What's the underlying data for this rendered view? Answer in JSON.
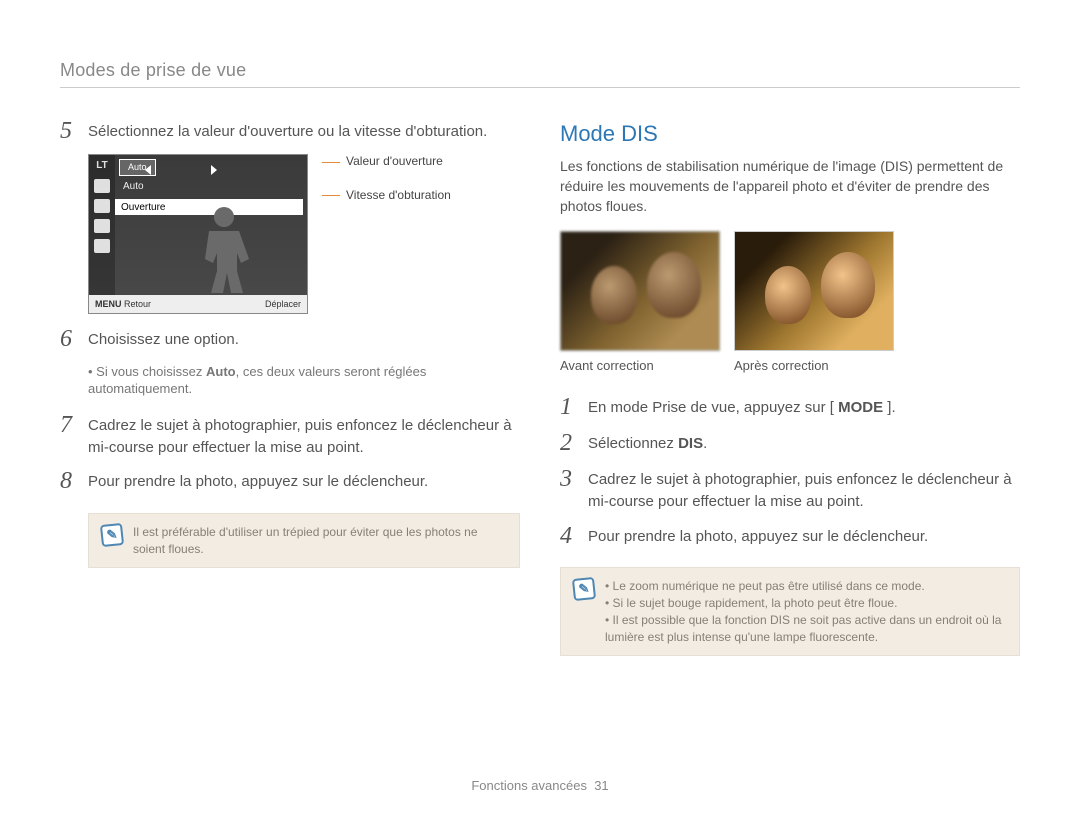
{
  "header": {
    "breadcrumb": "Modes de prise de vue"
  },
  "left": {
    "step5": "Sélectionnez la valeur d'ouverture ou la vitesse d'obturation.",
    "lcd": {
      "lt": "LT",
      "row1_pill": "Auto",
      "row2_lbl": "Auto",
      "openline": "Ouverture",
      "footer_menu": "MENU",
      "footer_ret": "Retour",
      "footer_dep": "Déplacer"
    },
    "annot": {
      "a1": "Valeur d'ouverture",
      "a2": "Vitesse d'obturation"
    },
    "step6": "Choisissez une option.",
    "step6_note_pre": "Si vous choisissez ",
    "step6_note_bold": "Auto",
    "step6_note_post": ", ces deux valeurs seront réglées automatiquement.",
    "step7": "Cadrez le sujet à photographier, puis enfoncez le déclencheur à mi-course pour effectuer la mise au point.",
    "step8": "Pour prendre la photo, appuyez sur le déclencheur.",
    "note": "Il est préférable d'utiliser un trépied pour éviter que les photos ne soient floues."
  },
  "right": {
    "title": "Mode DIS",
    "intro": "Les fonctions de stabilisation numérique de l'image (DIS) permettent de réduire les mouvements de l'appareil photo et d'éviter de prendre des photos floues.",
    "cap_before": "Avant correction",
    "cap_after": "Après correction",
    "step1_pre": "En mode Prise de vue, appuyez sur [ ",
    "step1_bold": "MODE",
    "step1_post": " ].",
    "step2_pre": "Sélectionnez ",
    "step2_bold": "DIS",
    "step2_post": ".",
    "step3": "Cadrez le sujet à photographier, puis enfoncez le déclencheur à mi-course pour effectuer la mise au point.",
    "step4": "Pour prendre la photo, appuyez sur le déclencheur.",
    "notes": {
      "n1": "Le zoom numérique ne peut pas être utilisé dans ce mode.",
      "n2": "Si le sujet bouge rapidement, la photo peut être floue.",
      "n3": "Il est possible que la fonction DIS ne soit pas active dans un endroit où la lumière est plus intense qu'une lampe fluorescente."
    }
  },
  "footer": {
    "section": "Fonctions avancées",
    "page": "31"
  }
}
